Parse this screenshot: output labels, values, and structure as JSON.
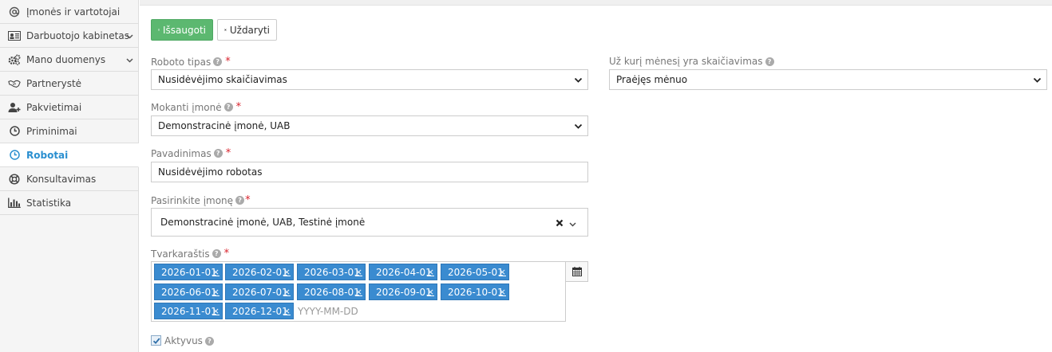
{
  "sidebar": {
    "items": [
      {
        "label": "Įmonės ir vartotojai",
        "icon": "at-icon"
      },
      {
        "label": "Darbuotojo kabinetas",
        "icon": "id-card-icon",
        "has_chevron": true
      },
      {
        "label": "Mano duomenys",
        "icon": "gears-icon",
        "has_chevron": true
      },
      {
        "label": "Partnerystė",
        "icon": "handshake-icon"
      },
      {
        "label": "Pakvietimai",
        "icon": "user-plus-icon"
      },
      {
        "label": "Priminimai",
        "icon": "clock-icon"
      },
      {
        "label": "Robotai",
        "icon": "clock-icon",
        "active": true
      },
      {
        "label": "Konsultavimas",
        "icon": "life-ring-icon"
      },
      {
        "label": "Statistika",
        "icon": "bar-chart-icon"
      }
    ]
  },
  "toolbar": {
    "save_label": "Išsaugoti",
    "close_label": "Uždaryti"
  },
  "form": {
    "robot_type": {
      "label": "Roboto tipas",
      "value": "Nusidėvėjimo skaičiavimas"
    },
    "month": {
      "label": "Už kurį mėnesį yra skaičiavimas",
      "value": "Praėjęs mėnuo"
    },
    "paying_company": {
      "label": "Mokanti įmonė",
      "value": "Demonstracinė įmonė, UAB"
    },
    "name": {
      "label": "Pavadinimas",
      "value": "Nusidėvėjimo robotas"
    },
    "select_company": {
      "label": "Pasirinkite įmonę",
      "value": "Demonstracinė įmonė, UAB, Testinė įmonė"
    },
    "schedule": {
      "label": "Tvarkaraštis",
      "dates": [
        "2026-01-01",
        "2026-02-01",
        "2026-03-01",
        "2026-04-01",
        "2026-05-01",
        "2026-06-01",
        "2026-07-01",
        "2026-08-01",
        "2026-09-01",
        "2026-10-01",
        "2026-11-01",
        "2026-12-01"
      ],
      "placeholder": "YYYY-MM-DD"
    },
    "active": {
      "label": "Aktyvus",
      "checked": true
    }
  },
  "colors": {
    "accent": "#2a8fd0",
    "save_button": "#5cb870",
    "tag": "#3a8bd0",
    "required": "#d9232d"
  }
}
